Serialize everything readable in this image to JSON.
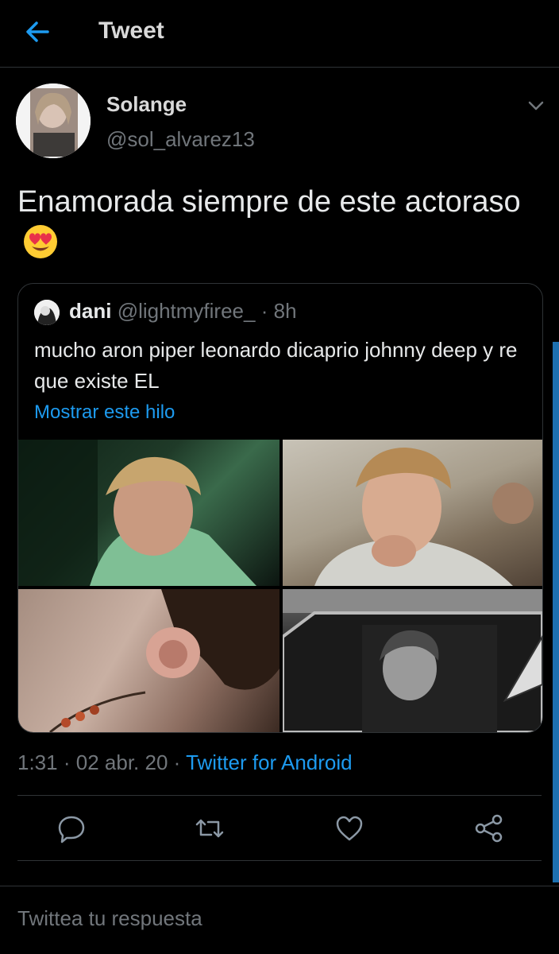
{
  "header": {
    "title": "Tweet",
    "back_icon": "arrow-left-icon"
  },
  "tweet": {
    "author_name": "Solange",
    "author_handle": "@sol_alvarez13",
    "text": "Enamorada siempre de este actoraso",
    "emoji": "heart-eyes-emoji",
    "time": "1:31",
    "date": "02 abr. 20",
    "separator": "·",
    "source": "Twitter for Android"
  },
  "quote": {
    "name": "dani",
    "handle": "@lightmyfiree_",
    "separator": "·",
    "time": "8h",
    "text": "mucho aron piper leonardo dicaprio johnny deep y re que existe EL",
    "show_thread": "Mostrar este hilo"
  },
  "actions": [
    "reply-icon",
    "retweet-icon",
    "like-icon",
    "share-icon"
  ],
  "reply": {
    "placeholder": "Twittea tu respuesta"
  },
  "colors": {
    "background": "#000000",
    "accent": "#1d9bf0",
    "muted": "#71767b",
    "border": "#2f3336"
  }
}
